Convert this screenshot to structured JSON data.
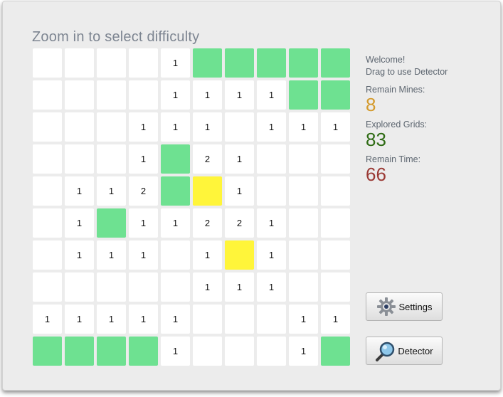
{
  "title": "Zoom in to select difficulty",
  "welcome": [
    "Welcome!",
    "Drag to use Detector"
  ],
  "stats": {
    "mines_label": "Remain Mines:",
    "mines_value": "8",
    "explored_label": "Explored Grids:",
    "explored_value": "83",
    "time_label": "Remain Time:",
    "time_value": "66"
  },
  "colors": {
    "mines": "#d49a2c",
    "explored": "#2e6b14",
    "time": "#9b3a35",
    "covered": "#6ee191",
    "detected": "#fff53a"
  },
  "buttons": {
    "settings": {
      "label": "Settings",
      "icon": "gear-icon"
    },
    "detector": {
      "label": "Detector",
      "icon": "magnifier-icon"
    }
  },
  "board": {
    "legend": {
      "G": "covered",
      "Y": "detected",
      "": "empty"
    },
    "rows": [
      [
        "",
        "",
        "",
        "",
        "1",
        "G",
        "G",
        "G",
        "G",
        "G"
      ],
      [
        "",
        "",
        "",
        "",
        "1",
        "1",
        "1",
        "1",
        "G",
        "G"
      ],
      [
        "",
        "",
        "",
        "1",
        "1",
        "1",
        "",
        "1",
        "1",
        "1"
      ],
      [
        "",
        "",
        "",
        "1",
        "G",
        "2",
        "1",
        "",
        "",
        ""
      ],
      [
        "",
        "1",
        "1",
        "2",
        "G",
        "Y",
        "1",
        "",
        "",
        ""
      ],
      [
        "",
        "1",
        "G",
        "1",
        "1",
        "2",
        "2",
        "1",
        "",
        ""
      ],
      [
        "",
        "1",
        "1",
        "1",
        "",
        "1",
        "Y",
        "1",
        "",
        ""
      ],
      [
        "",
        "",
        "",
        "",
        "",
        "1",
        "1",
        "1",
        "",
        ""
      ],
      [
        "1",
        "1",
        "1",
        "1",
        "1",
        "",
        "",
        "",
        "1",
        "1"
      ],
      [
        "G",
        "G",
        "G",
        "G",
        "1",
        "",
        "",
        "",
        "1",
        "G"
      ]
    ]
  }
}
